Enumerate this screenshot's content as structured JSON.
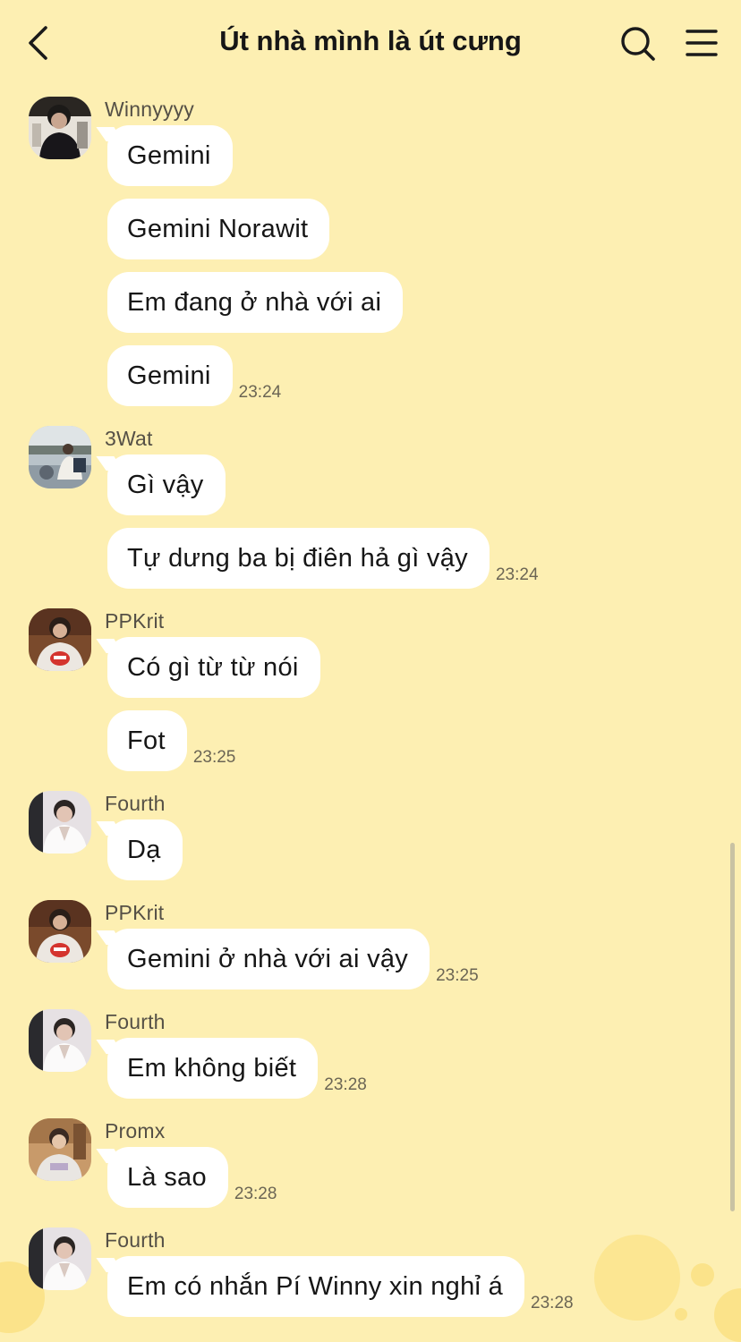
{
  "header": {
    "title": "Út nhà mình là út cưng",
    "back_icon": "chevron-left-icon",
    "search_icon": "search-icon",
    "menu_icon": "hamburger-menu-icon"
  },
  "colors": {
    "background": "#fdefb2",
    "bubble": "#ffffff",
    "time_text": "#6b6554",
    "sender_text": "#555046"
  },
  "messages": [
    {
      "sender": "Winnyyyy",
      "avatar": "avatar-winnyyyy",
      "bubbles": [
        "Gemini",
        "Gemini Norawit",
        "Em đang ở nhà với ai",
        "Gemini"
      ],
      "time": "23:24"
    },
    {
      "sender": "3Wat",
      "avatar": "avatar-3wat",
      "bubbles": [
        "Gì vậy",
        "Tự dưng ba bị điên hả gì vậy"
      ],
      "time": "23:24"
    },
    {
      "sender": "PPKrit",
      "avatar": "avatar-ppkrit",
      "bubbles": [
        "Có gì từ từ nói",
        "Fot"
      ],
      "time": "23:25"
    },
    {
      "sender": "Fourth",
      "avatar": "avatar-fourth",
      "bubbles": [
        "Dạ"
      ],
      "time": ""
    },
    {
      "sender": "PPKrit",
      "avatar": "avatar-ppkrit",
      "bubbles": [
        "Gemini ở nhà với ai vậy"
      ],
      "time": "23:25"
    },
    {
      "sender": "Fourth",
      "avatar": "avatar-fourth",
      "bubbles": [
        "Em không biết"
      ],
      "time": "23:28"
    },
    {
      "sender": "Promx",
      "avatar": "avatar-promx",
      "bubbles": [
        "Là sao"
      ],
      "time": "23:28"
    },
    {
      "sender": "Fourth",
      "avatar": "avatar-fourth",
      "bubbles": [
        "Em có nhắn Pí Winny xin nghỉ á"
      ],
      "time": "23:28"
    }
  ]
}
